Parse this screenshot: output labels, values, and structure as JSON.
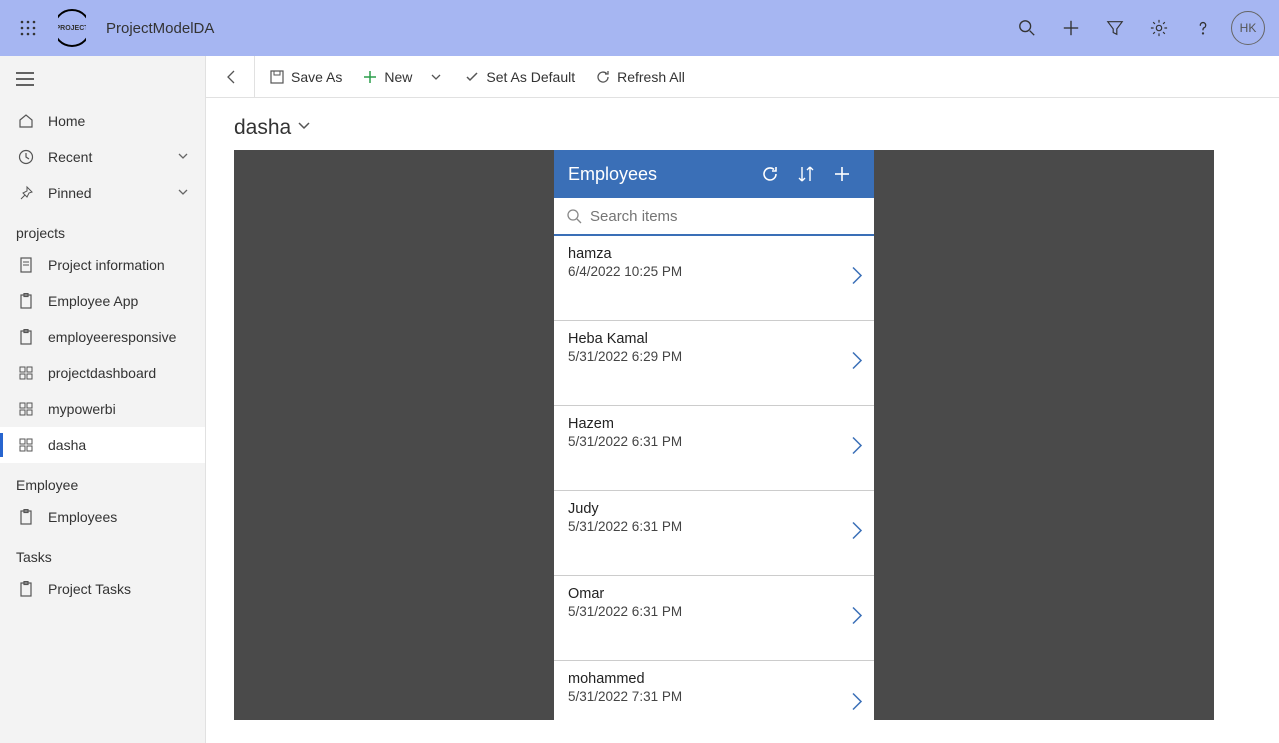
{
  "header": {
    "app_title": "ProjectModelDA",
    "avatar_initials": "HK"
  },
  "sidebar": {
    "home": "Home",
    "recent": "Recent",
    "pinned": "Pinned",
    "sections": {
      "projects": {
        "label": "projects",
        "items": [
          "Project information",
          "Employee App",
          "employeeresponsive",
          "projectdashboard",
          "mypowerbi",
          "dasha"
        ]
      },
      "employee": {
        "label": "Employee",
        "items": [
          "Employees"
        ]
      },
      "tasks": {
        "label": "Tasks",
        "items": [
          "Project Tasks"
        ]
      }
    }
  },
  "commandbar": {
    "save_as": "Save As",
    "new": "New",
    "set_default": "Set As Default",
    "refresh_all": "Refresh All"
  },
  "page": {
    "title": "dasha"
  },
  "panel": {
    "title": "Employees",
    "search_placeholder": "Search items",
    "items": [
      {
        "name": "hamza",
        "date": "6/4/2022 10:25 PM"
      },
      {
        "name": "Heba Kamal",
        "date": "5/31/2022 6:29 PM"
      },
      {
        "name": "Hazem",
        "date": "5/31/2022 6:31 PM"
      },
      {
        "name": "Judy",
        "date": "5/31/2022 6:31 PM"
      },
      {
        "name": "Omar",
        "date": "5/31/2022 6:31 PM"
      },
      {
        "name": "mohammed",
        "date": "5/31/2022 7:31 PM"
      }
    ]
  }
}
